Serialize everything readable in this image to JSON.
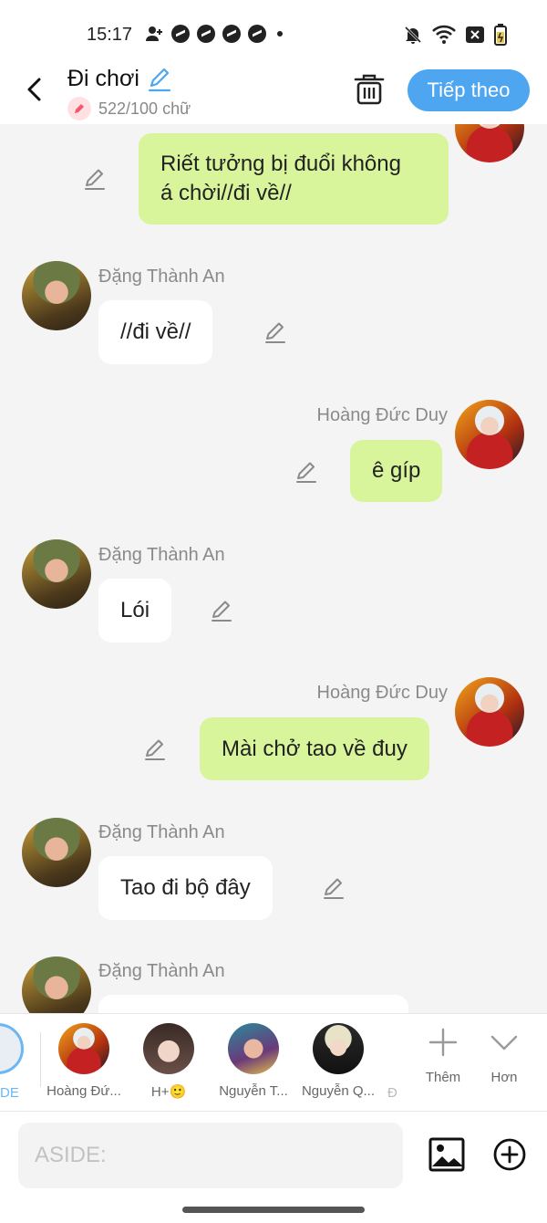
{
  "status_bar": {
    "time": "15:17",
    "left_icons": [
      "person-add-icon",
      "messenger-icon",
      "messenger-icon",
      "messenger-icon",
      "messenger-icon",
      "dot-icon"
    ],
    "right_icons": [
      "bell-off-icon",
      "wifi-icon",
      "close-box-icon",
      "battery-icon"
    ]
  },
  "header": {
    "title": "Đi chơi",
    "counter": "522/100 chữ",
    "next_label": "Tiếp theo"
  },
  "messages": [
    {
      "side": "mine",
      "text": "Riết tưởng bị đuổi không á chời//đi về//",
      "line1": "Riết tưởng bị đuổi không",
      "line2": "á chời//đi về//"
    },
    {
      "side": "theirs",
      "sender": "Đặng Thành An",
      "text": "//đi về//"
    },
    {
      "side": "mine",
      "sender": "Hoàng Đức Duy",
      "text": "ê gíp"
    },
    {
      "side": "theirs",
      "sender": "Đặng Thành An",
      "text": "Lói"
    },
    {
      "side": "mine",
      "sender": "Hoàng Đức Duy",
      "text": "Mài chở tao về đuy"
    },
    {
      "side": "theirs",
      "sender": "Đặng Thành An",
      "text": "Tao đi bộ đây"
    },
    {
      "side": "theirs",
      "sender": "Đặng Thành An",
      "text": ""
    }
  ],
  "friend_strip": {
    "partial_label": "DE",
    "friends": [
      {
        "name": "Hoàng Đứ..."
      },
      {
        "name": "H+🙂"
      },
      {
        "name": "Nguyễn T..."
      },
      {
        "name": "Nguyễn Q..."
      }
    ],
    "partial_next": "Đ",
    "more_label": "Thêm",
    "collapse_label": "Hơn"
  },
  "input": {
    "placeholder": "ASIDE:"
  },
  "colors": {
    "accent": "#4ea5f0",
    "my_bubble": "#d9f59c",
    "their_bubble": "#ffffff",
    "background": "#f4f4f4"
  }
}
